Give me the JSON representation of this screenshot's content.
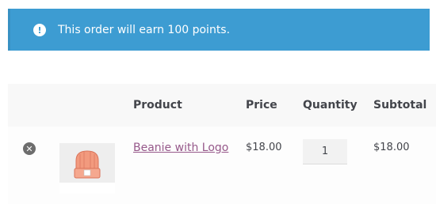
{
  "notice": {
    "icon": "exclamation-circle-icon",
    "text": "This order will earn 100 points.",
    "background": "#3d9cd2"
  },
  "cart_table": {
    "headers": {
      "product": "Product",
      "price": "Price",
      "quantity": "Quantity",
      "subtotal": "Subtotal"
    },
    "rows": [
      {
        "remove_icon": "remove-circle-icon",
        "thumbnail": "beanie-image",
        "name": "Beanie with Logo",
        "price": "$18.00",
        "quantity": "1",
        "subtotal": "$18.00"
      }
    ]
  },
  "colors": {
    "link": "#96588a",
    "text": "#43454b",
    "header_bg": "#f8f8f8"
  }
}
